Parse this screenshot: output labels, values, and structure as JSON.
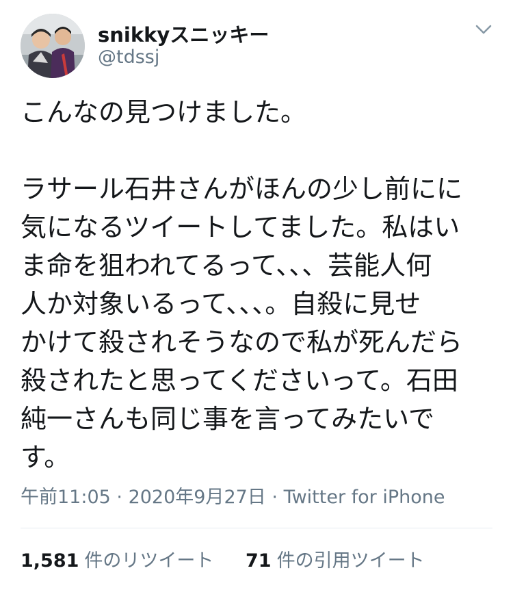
{
  "user": {
    "display_name": "snikkyスニッキー",
    "handle": "@tdssj"
  },
  "tweet": {
    "lines": [
      "こんなの見つけました。",
      "",
      "ラサール石井さんがほんの少し前にに",
      "気になるツイートしてました。私はい",
      "ま命を狙われてるって、、、芸能人何",
      "人か対象いるって、、、。自殺に見せ",
      "かけて殺されそうなので私が死んだら",
      "殺されたと思ってくださいって。石田",
      "純一さんも同じ事を言ってみたいで",
      "す。"
    ]
  },
  "meta": {
    "time": "午前11:05",
    "separator": " · ",
    "date": "2020年9月27日",
    "via": "Twitter for iPhone"
  },
  "stats": {
    "retweets_count": "1,581",
    "retweets_label": "件のリツイート",
    "quotes_count": "71",
    "quotes_label": "件の引用ツイート"
  },
  "icons": {
    "more": "chevron-down-icon"
  },
  "colors": {
    "text": "#14171a",
    "secondary": "#657786",
    "divider": "#e6ecf0"
  }
}
